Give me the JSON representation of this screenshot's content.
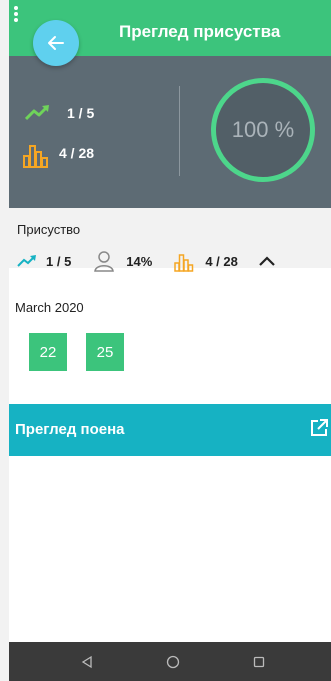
{
  "appbar": {
    "title": "Преглед присуства"
  },
  "summary": {
    "trend_value": "1 / 5",
    "attendance_value": "4 / 28",
    "percent": "100 %"
  },
  "attendance": {
    "title": "Присуство",
    "trend": "1 / 5",
    "absent_pct": "14%",
    "count": "4 / 28"
  },
  "calendar": {
    "month": "March 2020",
    "days": [
      "22",
      "25"
    ]
  },
  "points": {
    "title": "Преглед поена"
  },
  "colors": {
    "green": "#3cc47c",
    "slate": "#5d6b74",
    "teal": "#16b2c3",
    "orange": "#f5a623",
    "fab": "#5fd0ee"
  }
}
